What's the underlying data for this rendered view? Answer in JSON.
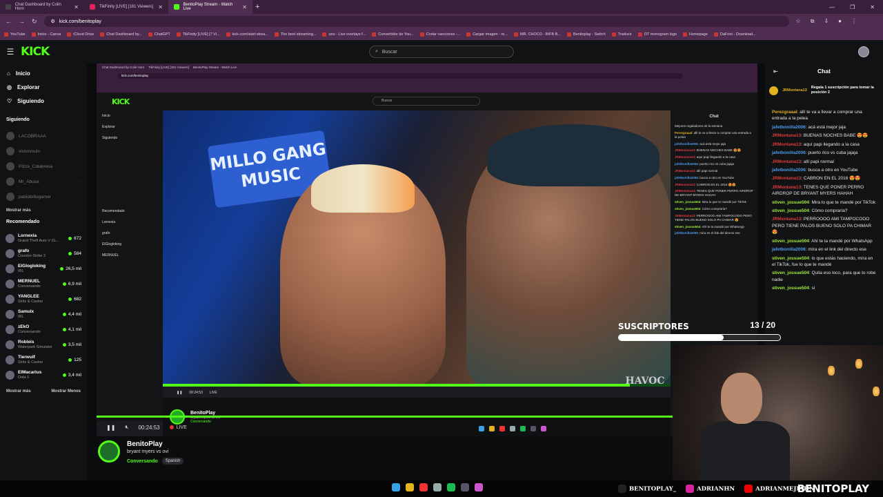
{
  "tabs": [
    {
      "label": "Chat Dashboard by Colin Horn",
      "color": "#444"
    },
    {
      "label": "TikFinity [LIVE] [181 Viewers]",
      "color": "#e0245e"
    },
    {
      "label": "BenitoPlay Stream - Watch Live",
      "color": "#53fc18"
    }
  ],
  "url": "kick.com/benitoplay",
  "bookmarks": [
    "YouTube",
    "Inicio - Canva",
    "iCloud Drive",
    "Chat Dashboard by...",
    "ChatGPT",
    "TikFinity [LIVE] [7 Vi...",
    "kick.com/start-strea...",
    "The best streaming...",
    "uno - Live overlays f...",
    "Convertidor de You...",
    "Cortar canciones -...",
    "Cargar imagen - re...",
    "MR. CHOCO - BIFB B...",
    "Benitoplay - Switch",
    "Traducir",
    "OT monogram logo",
    "Homepage",
    "DaFont - Download..."
  ],
  "header": {
    "logo": "KICK",
    "search_placeholder": "Buscar"
  },
  "sidebar": {
    "nav": [
      {
        "label": "Inicio",
        "icon": "home-icon"
      },
      {
        "label": "Explorar",
        "icon": "compass-icon"
      },
      {
        "label": "Siguiendo",
        "icon": "heart-icon"
      }
    ],
    "following_title": "Siguiendo",
    "following": [
      "LACOBRAAA",
      "victorvoulo",
      "Pizza_Calabresa",
      "Mr_Abusa",
      "pablobritogamer"
    ],
    "more": "Mostrar más",
    "recommended_title": "Recomendado",
    "recommended": [
      {
        "name": "Lornexia",
        "category": "Grand Theft Auto V (G...",
        "viewers": "672"
      },
      {
        "name": "grafo",
        "category": "Counter-Strike 2",
        "viewers": "584"
      },
      {
        "name": "ElGlogloking",
        "category": "IRL",
        "viewers": "26,5 mil"
      },
      {
        "name": "MERNUEL",
        "category": "Conversando",
        "viewers": "6,9 mil"
      },
      {
        "name": "YANGLEE",
        "category": "Slots & Casino",
        "viewers": "682"
      },
      {
        "name": "Samulx",
        "category": "IRL",
        "viewers": "4,4 mil"
      },
      {
        "name": "zEkO",
        "category": "Conversando",
        "viewers": "4,1 mil"
      },
      {
        "name": "Robleis",
        "category": "Waterpark Simulator",
        "viewers": "3,5 mil"
      },
      {
        "name": "Tierwulf",
        "category": "Slots & Casino",
        "viewers": "125"
      },
      {
        "name": "ElMacarius",
        "category": "Dota 2",
        "viewers": "3,4 mil"
      }
    ],
    "more2": "Mostrar más",
    "less": "Mostrar Menos"
  },
  "video": {
    "banner": "MILLO GANG MUSIC",
    "time": "00:24:53",
    "live": "LIVE",
    "progress": 1.0
  },
  "stream": {
    "streamer": "BenitoPlay",
    "title": "bryant myers vs ovi",
    "category": "Conversando",
    "language": "Spanish"
  },
  "chat": {
    "title": "Chat",
    "pinned_user": "JRMontana13",
    "pinned_msg": "Regala 1 suscripción para tomar la posición 2",
    "inner_top": "Mejores regaladores de la semana",
    "messages": [
      {
        "user": "Perezgraaal",
        "color": "#e4b21f",
        "text": "allí te va a llevar a comprar una entrada a la pelea"
      },
      {
        "user": "jafetbonilla2006",
        "color": "#4e9cf0",
        "text": "acá está mejor jaja"
      },
      {
        "user": "JRMontana13",
        "color": "#e23a3a",
        "text": "BUENAS NOCHES BABE 😍😍"
      },
      {
        "user": "JRMontana13",
        "color": "#e23a3a",
        "text": "aquí papi llegando a la casa"
      },
      {
        "user": "jafetbonilla2006",
        "color": "#4e9cf0",
        "text": "puerto rico vs cuba jajaja"
      },
      {
        "user": "JRMontana13",
        "color": "#e23a3a",
        "text": "allí papi normal"
      },
      {
        "user": "jafetbonilla2006",
        "color": "#4e9cf0",
        "text": "busca a otro en YouTube"
      },
      {
        "user": "JRMontana13",
        "color": "#e23a3a",
        "text": "CABRON EN EL 2016 😍😍"
      },
      {
        "user": "JRMontana13",
        "color": "#e23a3a",
        "text": "TENES QUE PONER PERRO AIRDROP DE BRYANT MYERS HAHAH"
      },
      {
        "user": "stiven_jossue504",
        "color": "#a3f03b",
        "text": "Mira lo que te mandé por TikTok"
      },
      {
        "user": "stiven_jossue504",
        "color": "#a3f03b",
        "text": "Cómo compraría?"
      },
      {
        "user": "JRMontana13",
        "color": "#e23a3a",
        "text": "PERROOOO AMI TAMPOCOOO PERO TIENE PALOS BUENO SOLO PA CHIMAR 😍"
      },
      {
        "user": "stiven_jossue504",
        "color": "#a3f03b",
        "text": "Ahí te la mandé por WhatsApp"
      },
      {
        "user": "jafetbonilla2006",
        "color": "#4e9cf0",
        "text": "míra en el link del directo ese"
      },
      {
        "user": "stiven_jossue504",
        "color": "#a3f03b",
        "text": "lo que estás haciendo, míra en el TikTok, fue lo que te mandé"
      },
      {
        "user": "stiven_jossue504",
        "color": "#a3f03b",
        "text": "Quita eso loco, para que to robe nadie"
      },
      {
        "user": "stiven_jossue504",
        "color": "#a3f03b",
        "text": "si"
      }
    ]
  },
  "overlay": {
    "subs_label": "SUSCRIPTORES",
    "subs_count": "13",
    "subs_goal": "/ 20",
    "subs_fraction": 0.65,
    "havoc": "HAVOC"
  },
  "socials": [
    {
      "icon": "tiktok-icon",
      "label": "BENITOPLAY_",
      "color": "#222"
    },
    {
      "icon": "instagram-icon",
      "label": "ADRIANHN",
      "color": "#d6249f"
    },
    {
      "icon": "youtube-icon",
      "label": "ADRIANMEJIAHN",
      "color": "#e00"
    }
  ],
  "brand": "BENITOPLAY"
}
